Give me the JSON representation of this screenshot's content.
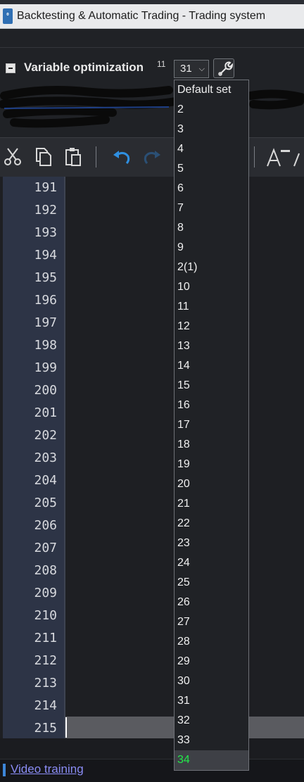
{
  "window": {
    "title": "Backtesting & Automatic Trading - Trading system",
    "app_icon": "trading-app-icon"
  },
  "optimization": {
    "label": "Variable optimization",
    "count": "11",
    "selected": "31",
    "tool_icon": "wrench-icon"
  },
  "toolbar": {
    "icons": [
      "cut-icon",
      "copy-icon",
      "paste-icon",
      "undo-icon",
      "redo-icon",
      "font-size-icon"
    ]
  },
  "editor": {
    "line_numbers": [
      "191",
      "192",
      "193",
      "194",
      "195",
      "196",
      "197",
      "198",
      "199",
      "200",
      "201",
      "202",
      "203",
      "204",
      "205",
      "206",
      "207",
      "208",
      "209",
      "210",
      "211",
      "212",
      "213",
      "214",
      "215"
    ],
    "current_line": "215"
  },
  "dropdown": {
    "options": [
      "Default set",
      "2",
      "3",
      "4",
      "5",
      "6",
      "7",
      "8",
      "9",
      "2(1)",
      "10",
      "11",
      "12",
      "13",
      "14",
      "15",
      "16",
      "17",
      "18",
      "19",
      "20",
      "21",
      "22",
      "23",
      "24",
      "25",
      "26",
      "27",
      "28",
      "29",
      "30",
      "31",
      "32",
      "33",
      "34"
    ],
    "highlighted": "34",
    "highlight_color": "#23e84a"
  },
  "footer": {
    "link": "Video training"
  },
  "colors": {
    "gutter": "#2d3446",
    "editor_bg": "#1e1f23",
    "accent_blue": "#3d86d8"
  }
}
